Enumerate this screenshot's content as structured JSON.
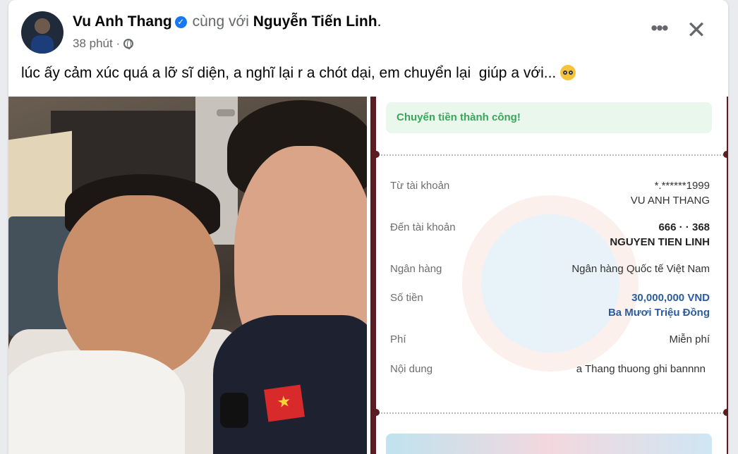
{
  "post": {
    "author": "Vu Anh Thang",
    "with_text": "cùng với",
    "tagged": "Nguyễn Tiến Linh",
    "tagged_suffix": ".",
    "time": "38 phút",
    "separator": "·",
    "caption": "lúc ấy cảm xúc quá a lỡ sĩ diện, a nghĩ lại r a chót dại, em chuyển lại  giúp a với... ",
    "more_glyph": "•••",
    "close_glyph": "✕",
    "verified_glyph": "✓"
  },
  "receipt": {
    "success_text": "Chuyển tiền thành công!",
    "rows": [
      {
        "label": "Từ tài khoản",
        "value": "*.******1999",
        "value2": "VU ANH THANG"
      },
      {
        "label": "Đến tài khoản",
        "value": "666  · · 368",
        "value2": "NGUYEN TIEN LINH"
      },
      {
        "label": "Ngân hàng",
        "value": "Ngân hàng Quốc tế Việt Nam"
      },
      {
        "label": "Số tiền",
        "value": "30,000,000 VND",
        "value2": "Ba Mươi Triệu Đồng"
      },
      {
        "label": "Phí",
        "value": "Miễn phí"
      },
      {
        "label": "Nội dung",
        "value": "a Thang thuong ghi bannnn"
      }
    ]
  },
  "icons": {
    "verified": "verified-badge-icon",
    "globe": "globe-icon",
    "more": "more-options-icon",
    "close": "close-icon",
    "emoji": "pleading-face-emoji"
  }
}
